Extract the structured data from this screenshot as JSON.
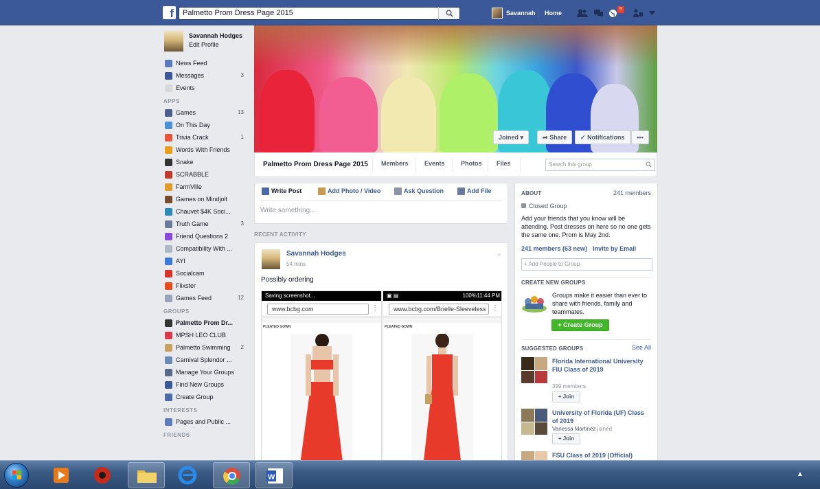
{
  "topbar": {
    "search_value": "Palmetto Prom Dress Page 2015",
    "user_name": "Savannah",
    "home_label": "Home",
    "notification_count": "5"
  },
  "profile": {
    "name": "Savannah Hodges",
    "edit_label": "Edit Profile"
  },
  "nav": {
    "favorites": [
      {
        "label": "News Feed",
        "count": "",
        "icon_color": "#5b7bbd"
      },
      {
        "label": "Messages",
        "count": "3",
        "icon_color": "#3b5998"
      },
      {
        "label": "Events",
        "count": "",
        "icon_color": "#d9d9d9"
      }
    ],
    "apps_label": "APPS",
    "apps": [
      {
        "label": "Games",
        "count": "13",
        "icon_color": "#4a5f8c"
      },
      {
        "label": "On This Day",
        "count": "",
        "icon_color": "#4a90d9"
      },
      {
        "label": "Trivia Crack",
        "count": "1",
        "icon_color": "#e8553a"
      },
      {
        "label": "Words With Friends",
        "count": "",
        "icon_color": "#e8a01a"
      },
      {
        "label": "Snake",
        "count": "",
        "icon_color": "#333333"
      },
      {
        "label": "SCRABBLE",
        "count": "",
        "icon_color": "#c0392b"
      },
      {
        "label": "FarmVille",
        "count": "",
        "icon_color": "#e39a2a"
      },
      {
        "label": "Games on Mindjolt",
        "count": "",
        "icon_color": "#7a4a2a"
      },
      {
        "label": "Chauvet $4K Soci...",
        "count": "",
        "icon_color": "#2a8ab8"
      },
      {
        "label": "Truth Game",
        "count": "3",
        "icon_color": "#6a7a9a"
      },
      {
        "label": "Friend Questions 2",
        "count": "",
        "icon_color": "#8a4ad9"
      },
      {
        "label": "Compatibility With ...",
        "count": "",
        "icon_color": "#b0b8c8"
      },
      {
        "label": "AYI",
        "count": "",
        "icon_color": "#3a7ad9"
      },
      {
        "label": "Socialcam",
        "count": "",
        "icon_color": "#d9332a"
      },
      {
        "label": "Flixster",
        "count": "",
        "icon_color": "#e84a1a"
      },
      {
        "label": "Games Feed",
        "count": "12",
        "icon_color": "#9aa4b8"
      }
    ],
    "groups_label": "GROUPS",
    "groups": [
      {
        "label": "Palmetto Prom Dr...",
        "count": "",
        "icon_color": "#333333",
        "bold": true
      },
      {
        "label": "MPSH LEO CLUB",
        "count": "",
        "icon_color": "#d93a4a"
      },
      {
        "label": "Palmetto Swimming",
        "count": "2",
        "icon_color": "#c8a060"
      },
      {
        "label": "Carnival Splendor ...",
        "count": "",
        "icon_color": "#6a8ab8"
      },
      {
        "label": "Manage Your Groups",
        "count": "",
        "icon_color": "#5a6a8a"
      },
      {
        "label": "Find New Groups",
        "count": "",
        "icon_color": "#3b5998"
      },
      {
        "label": "Create Group",
        "count": "",
        "icon_color": "#4a6aa8"
      }
    ],
    "interests_label": "INTERESTS",
    "interests": [
      {
        "label": "Pages and Public ...",
        "count": "",
        "icon_color": "#5b7bbd"
      }
    ],
    "friends_label": "FRIENDS"
  },
  "group": {
    "name": "Palmetto Prom Dress Page 2015",
    "tabs": [
      "Members",
      "Events",
      "Photos",
      "Files"
    ],
    "search_placeholder": "Search this group",
    "joined_label": "Joined",
    "share_label": "Share",
    "notifications_label": "Notifications",
    "more_label": "•••"
  },
  "composer": {
    "write_post": "Write Post",
    "add_photo": "Add Photo / Video",
    "ask_question": "Ask Question",
    "add_file": "Add File",
    "placeholder": "Write something..."
  },
  "feed": {
    "recent_label": "RECENT ACTIVITY",
    "post": {
      "author": "Savannah Hodges",
      "time": "54 mins",
      "text": "Possibly ordering",
      "shot1": {
        "status": "Saving screenshot...",
        "url": "www.bcbg.com",
        "category": "PLEATED GOWN"
      },
      "shot2": {
        "status_time": "11:44 PM",
        "status_battery": "100%",
        "url": "www.bcbg.com/Brielle-Sleeveless",
        "category": "PLEATED GOWN"
      }
    }
  },
  "about": {
    "title": "ABOUT",
    "members": "241 members",
    "closed": "Closed Group",
    "description": "Add your friends that you know will be attending. Post dresses on here so no one gets the same one. Prom is May 2nd.",
    "members_new": "241 members (63 new)",
    "separator": "·",
    "invite": "Invite by Email",
    "add_people": "+ Add People to Group"
  },
  "create_group": {
    "title": "CREATE NEW GROUPS",
    "description": "Groups make it easier than ever to share with friends, family and teammates.",
    "button": "+ Create Group"
  },
  "suggested": {
    "title": "SUGGESTED GROUPS",
    "see_all": "See All",
    "items": [
      {
        "name": "Florida International University FIU Class of 2019",
        "meta": "399 members",
        "join": "+ Join"
      },
      {
        "name": "University of Florida (UF) Class of 2019",
        "meta_name": "Vanessa Martinez",
        "meta_suffix": "joined",
        "join": "+ Join"
      },
      {
        "name": "FSU Class of 2019 (Official)"
      }
    ]
  },
  "colors": {
    "brand": "#3b5998",
    "create_green": "#42b72a",
    "page_bg": "#e9eaed"
  }
}
